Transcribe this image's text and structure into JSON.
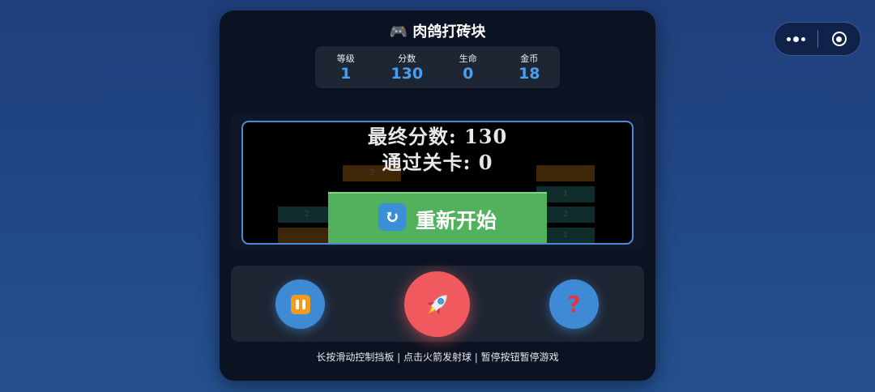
{
  "header": {
    "title": "🎮 肉鸽打砖块"
  },
  "stats": [
    {
      "label": "等级",
      "value": "1"
    },
    {
      "label": "分数",
      "value": "130"
    },
    {
      "label": "生命",
      "value": "0"
    },
    {
      "label": "金币",
      "value": "18"
    }
  ],
  "game_over": {
    "final_score": "最终分数: 130",
    "levels_passed": "通过关卡: 0",
    "hint_behind": "长按滑动控制挡板",
    "restart_icon": "🔄",
    "restart_label": "重新开始"
  },
  "bricks": [
    "2",
    "2",
    "1",
    "2",
    "1",
    "1"
  ],
  "controls": {
    "pause_icon": "pause-icon",
    "fire_icon": "rocket-icon",
    "help_icon": "question-icon"
  },
  "footer": {
    "instructions": "长按滑动控制挡板 | 点击火箭发射球 | 暂停按钮暂停游戏"
  },
  "colors": {
    "accent_blue": "#4a9ef0",
    "restart_green": "#52b15c",
    "fire_red": "#f05a5f",
    "panel_bg": "#0b1221"
  }
}
